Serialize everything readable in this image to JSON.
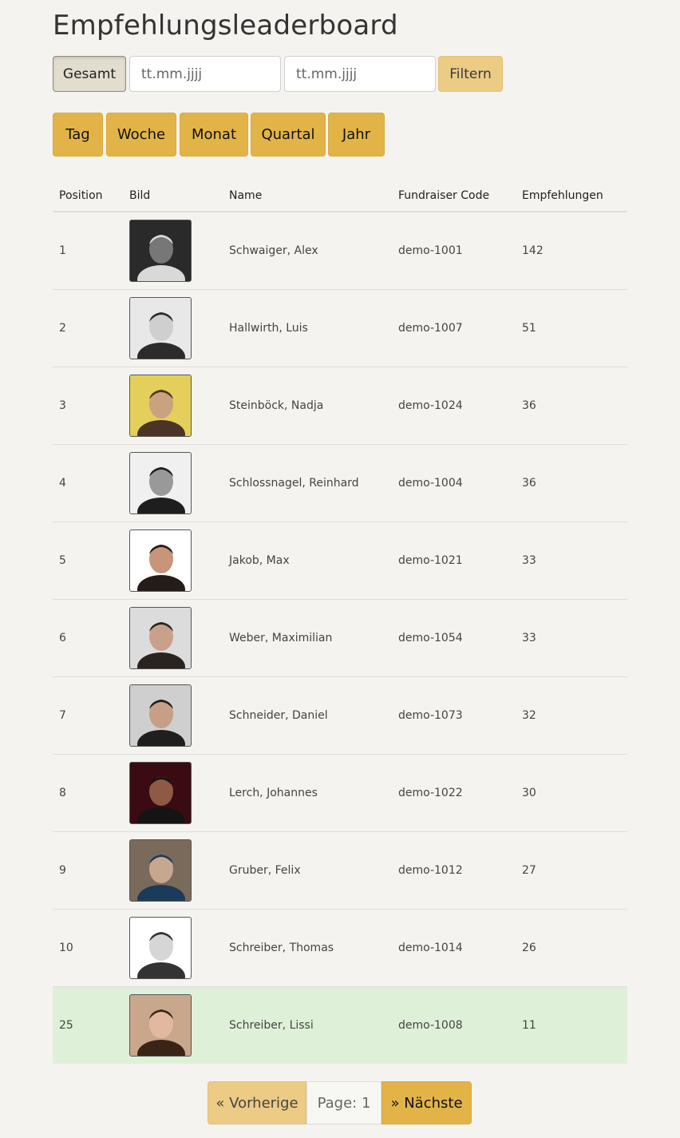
{
  "page_title": "Empfehlungsleaderboard",
  "filters": {
    "gesamt_label": "Gesamt",
    "date_from_placeholder": "tt.mm.jjjj",
    "date_to_placeholder": "tt.mm.jjjj",
    "filter_label": "Filtern"
  },
  "periods": [
    "Tag",
    "Woche",
    "Monat",
    "Quartal",
    "Jahr"
  ],
  "table": {
    "headers": [
      "Position",
      "Bild",
      "Name",
      "Fundraiser Code",
      "Empfehlungen"
    ],
    "rows": [
      {
        "position": "1",
        "name": "Schwaiger, Alex",
        "code": "demo-1001",
        "count": "142"
      },
      {
        "position": "2",
        "name": "Hallwirth, Luis",
        "code": "demo-1007",
        "count": "51"
      },
      {
        "position": "3",
        "name": "Steinböck, Nadja",
        "code": "demo-1024",
        "count": "36"
      },
      {
        "position": "4",
        "name": "Schlossnagel, Reinhard",
        "code": "demo-1004",
        "count": "36"
      },
      {
        "position": "5",
        "name": "Jakob, Max",
        "code": "demo-1021",
        "count": "33"
      },
      {
        "position": "6",
        "name": "Weber, Maximilian",
        "code": "demo-1054",
        "count": "33"
      },
      {
        "position": "7",
        "name": "Schneider, Daniel",
        "code": "demo-1073",
        "count": "32"
      },
      {
        "position": "8",
        "name": "Lerch, Johannes",
        "code": "demo-1022",
        "count": "30"
      },
      {
        "position": "9",
        "name": "Gruber, Felix",
        "code": "demo-1012",
        "count": "27"
      },
      {
        "position": "10",
        "name": "Schreiber, Thomas",
        "code": "demo-1014",
        "count": "26"
      },
      {
        "position": "25",
        "name": "Schreiber, Lissi",
        "code": "demo-1008",
        "count": "11"
      }
    ]
  },
  "pagination": {
    "prev_label": "« Vorherige",
    "page_label": "Page: 1",
    "next_label": "» Nächste"
  },
  "colors": {
    "background": "#f4f3ef",
    "accent": "#e2b448",
    "accent_light": "#eccb85",
    "highlight_row": "#dff0d8"
  }
}
